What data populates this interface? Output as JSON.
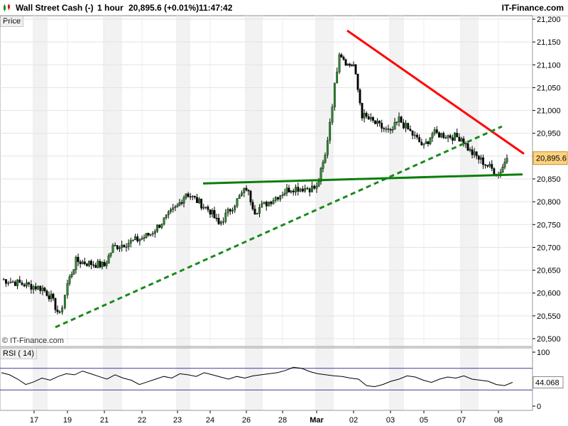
{
  "header": {
    "instrument": "Wall Street Cash (-)",
    "timeframe": "1 hour",
    "price_change": "20,895.6 (+0.01%)",
    "time": "11:47:42",
    "brand": "IT-Finance.com",
    "price_tab": "Price",
    "copyright": "© IT-Finance.com"
  },
  "colors": {
    "resistance": "#ff0000",
    "trend_support": "#1a8a1a",
    "horizontal_support": "#0a7d0a",
    "candle_up": "#2a8a2a",
    "candle_down": "#000000",
    "rsi_line": "#000000",
    "rsi_band": "#3a3a9a",
    "rsi_overbought_fill": "#c8a0a0",
    "current_price_box": "#ffd27f"
  },
  "chart_data": [
    {
      "type": "candlestick",
      "title": "",
      "ylim": [
        20500,
        21200
      ],
      "yticks": [
        "20,500",
        "20,550",
        "20,600",
        "20,650",
        "20,700",
        "20,750",
        "20,800",
        "20,850",
        "20,900",
        "20,950",
        "21,000",
        "21,050",
        "21,100",
        "21,150",
        "21,200"
      ],
      "xticks": [
        "17",
        "19",
        "21",
        "22",
        "23",
        "24",
        "26",
        "28",
        "Mar",
        "02",
        "03",
        "05",
        "07",
        "08"
      ],
      "last_price_label": "20,895.6",
      "close_path": [
        [
          "17",
          20630
        ],
        [
          "17",
          20610
        ],
        [
          "18",
          20590
        ],
        [
          "18",
          20550
        ],
        [
          "19",
          20620
        ],
        [
          "19",
          20670
        ],
        [
          "21",
          20660
        ],
        [
          "21",
          20700
        ],
        [
          "22",
          20720
        ],
        [
          "22",
          20730
        ],
        [
          "23",
          20790
        ],
        [
          "23",
          20820
        ],
        [
          "24",
          20780
        ],
        [
          "24",
          20750
        ],
        [
          "26",
          20830
        ],
        [
          "26",
          20780
        ],
        [
          "28",
          20820
        ],
        [
          "28",
          20830
        ],
        [
          "Mar",
          20830
        ],
        [
          "Mar",
          20900
        ],
        [
          "01",
          21130
        ],
        [
          "01",
          21100
        ],
        [
          "02",
          21100
        ],
        [
          "02",
          20990
        ],
        [
          "03",
          20950
        ],
        [
          "03",
          20980
        ],
        [
          "05",
          20920
        ],
        [
          "05",
          20950
        ],
        [
          "07",
          20940
        ],
        [
          "07",
          20910
        ],
        [
          "08",
          20860
        ],
        [
          "08",
          20895.6
        ]
      ],
      "trendlines": [
        {
          "name": "",
          "style": "solid",
          "color": "#ff0000",
          "from": [
            "Mar",
            21175
          ],
          "to": [
            "08",
            20905
          ]
        },
        {
          "name": "",
          "style": "dashed",
          "color": "#1a8a1a",
          "from": [
            "18",
            20525
          ],
          "to": [
            "07",
            20965
          ]
        },
        {
          "name": "",
          "style": "solid",
          "color": "#0a7d0a",
          "from": [
            "23",
            20840
          ],
          "to": [
            "08",
            20860
          ]
        }
      ]
    },
    {
      "type": "line",
      "title": "",
      "label": "RSI ( 14)",
      "ylim": [
        0,
        100
      ],
      "yticks": [
        "0",
        "100"
      ],
      "bands": [
        30,
        70
      ],
      "last_value_label": "44.068",
      "values": [
        62,
        58,
        50,
        40,
        45,
        52,
        48,
        55,
        60,
        58,
        65,
        60,
        55,
        50,
        58,
        52,
        48,
        40,
        45,
        50,
        55,
        52,
        60,
        58,
        55,
        62,
        58,
        54,
        50,
        55,
        52,
        56,
        58,
        60,
        62,
        66,
        72,
        70,
        64,
        60,
        58,
        56,
        55,
        52,
        50,
        38,
        36,
        40,
        46,
        50,
        56,
        54,
        48,
        44,
        50,
        54,
        52,
        56,
        50,
        48,
        46,
        40,
        38,
        44.068
      ]
    }
  ]
}
